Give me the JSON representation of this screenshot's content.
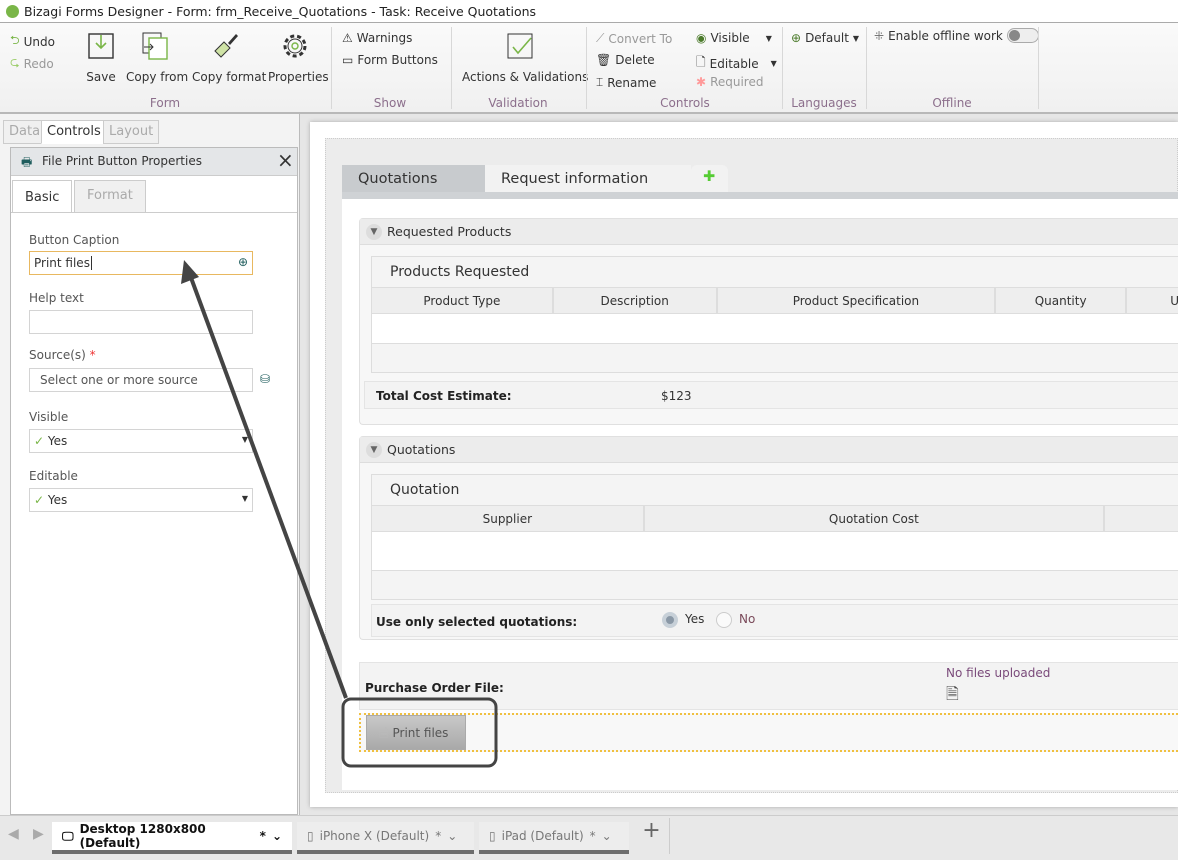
{
  "window": {
    "title": "Bizagi Forms Designer  - Form: frm_Receive_Quotations - Task: Receive Quotations"
  },
  "ribbon": {
    "form": {
      "undo": "Undo",
      "redo": "Redo",
      "save": "Save",
      "copy_from": "Copy from",
      "copy_format": "Copy format",
      "properties": "Properties",
      "label": "Form"
    },
    "show": {
      "warnings": "Warnings",
      "form_buttons": "Form Buttons",
      "label": "Show"
    },
    "validation": {
      "actions": "Actions & Validations",
      "label": "Validation"
    },
    "controls": {
      "convert_to": "Convert To",
      "delete": "Delete",
      "rename": "Rename",
      "visible": "Visible",
      "editable": "Editable",
      "required": "Required",
      "label": "Controls"
    },
    "languages": {
      "default": "Default",
      "label": "Languages"
    },
    "offline": {
      "enable": "Enable offline work",
      "enabled": false,
      "label": "Offline"
    }
  },
  "left_tabs": [
    {
      "label": "Data"
    },
    {
      "label": "Controls",
      "active": true
    },
    {
      "label": "Layout"
    }
  ],
  "properties": {
    "title": "File Print Button Properties",
    "tabs": [
      {
        "label": "Basic",
        "active": true
      },
      {
        "label": "Format"
      }
    ],
    "button_caption_label": "Button Caption",
    "button_caption_value": "Print files",
    "help_text_label": "Help text",
    "help_text_value": "",
    "sources_label": "Source(s)",
    "required_mark": "*",
    "sources_placeholder": "Select one or more source",
    "visible_label": "Visible",
    "visible_value": "Yes",
    "editable_label": "Editable",
    "editable_value": "Yes"
  },
  "form": {
    "tabs": [
      {
        "label": "Quotations",
        "active": true
      },
      {
        "label": "Request information"
      }
    ],
    "requested_products": {
      "title": "Requested Products",
      "grid_title": "Products Requested",
      "columns": [
        "Product Type",
        "Description",
        "Product Specification",
        "Quantity",
        "U"
      ],
      "total_label": "Total Cost Estimate:",
      "total_value": "$123"
    },
    "quotations": {
      "title": "Quotations",
      "grid_title": "Quotation",
      "columns": [
        "Supplier",
        "Quotation Cost",
        ""
      ],
      "use_selected_label": "Use only selected quotations:",
      "options": [
        "Yes",
        "No"
      ],
      "selected": "Yes"
    },
    "purchase_order": {
      "label": "Purchase Order File:",
      "status": "No files uploaded"
    },
    "print_button": "Print files"
  },
  "devices": [
    {
      "label": "Desktop 1280x800 (Default)",
      "modified": "*",
      "active": true
    },
    {
      "label": "iPhone X (Default)",
      "modified": "*"
    },
    {
      "label": "iPad (Default)",
      "modified": "*"
    }
  ],
  "colors": {
    "accent": "#7ab648",
    "callout": "#444444",
    "selection": "#f0c040"
  }
}
